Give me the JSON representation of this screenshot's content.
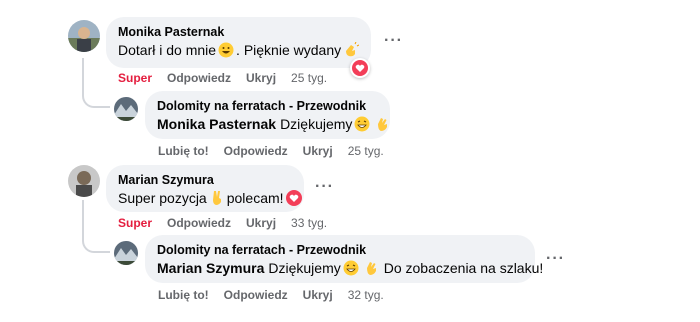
{
  "comments": [
    {
      "author": "Monika Pasternak",
      "text": "Dotarł i do mnie",
      "text_after": ". Pięknie wydany",
      "actions": {
        "like": "Super",
        "reply": "Odpowiedz",
        "hide": "Ukryj",
        "time": "25 tyg."
      },
      "reply": {
        "author": "Dolomity na ferratach - Przewodnik",
        "mention": "Monika Pasternak",
        "text": "Dziękujemy",
        "actions": {
          "like": "Lubię to!",
          "reply": "Odpowiedz",
          "hide": "Ukryj",
          "time": "25 tyg."
        }
      }
    },
    {
      "author": "Marian Szymura",
      "text": "Super pozycja",
      "text_after": "polecam!",
      "actions": {
        "like": "Super",
        "reply": "Odpowiedz",
        "hide": "Ukryj",
        "time": "33 tyg."
      },
      "reply": {
        "author": "Dolomity na ferratach - Przewodnik",
        "mention": "Marian Szymura",
        "text": "Dziękujemy",
        "text_after": "Do zobaczenia na szlaku!",
        "actions": {
          "like": "Lubię to!",
          "reply": "Odpowiedz",
          "hide": "Ukryj",
          "time": "32 tyg."
        }
      }
    }
  ],
  "more_label": "···",
  "colors": {
    "super": "#e41e3f",
    "meta": "#65676b",
    "bubble": "#f0f2f5"
  },
  "icons": [
    "grinning-emoji",
    "clapping-hands-emoji",
    "heart-reaction-icon",
    "waving-hand-emoji",
    "victory-hand-emoji"
  ]
}
